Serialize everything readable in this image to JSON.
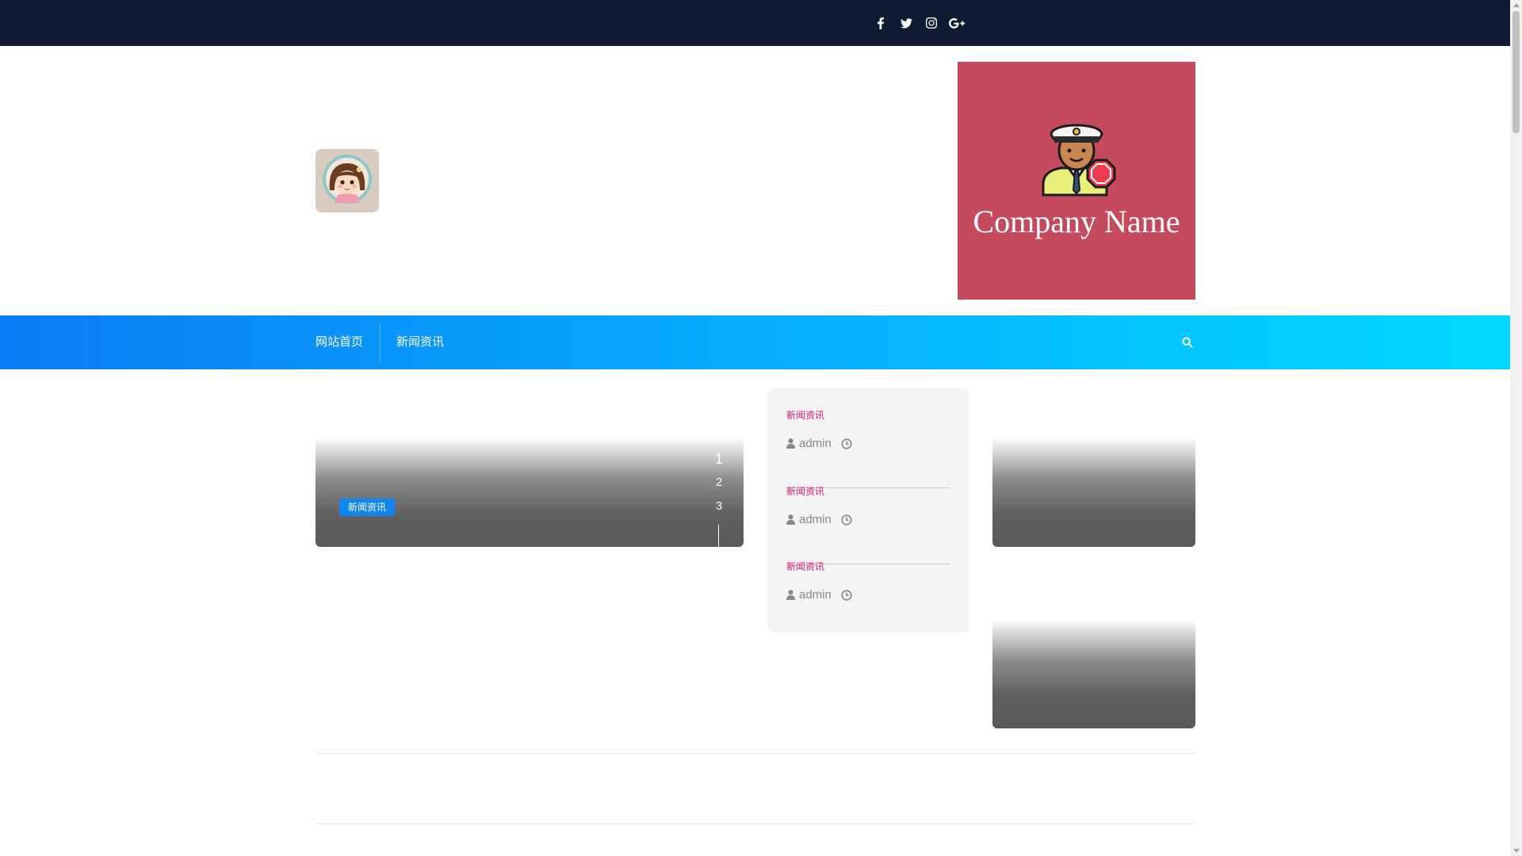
{
  "topbar": {
    "social_icons": [
      "facebook-icon",
      "twitter-icon",
      "instagram-icon",
      "google-plus-icon"
    ]
  },
  "header": {
    "logo_icon": "girl-avatar-logo",
    "banner": {
      "company_name": "Company Name",
      "icon": "security-guard-icon",
      "background": "#c54a5e"
    }
  },
  "nav": {
    "items": [
      {
        "label": "网站首页"
      },
      {
        "label": "新闻资讯"
      }
    ],
    "search_icon": "search-icon"
  },
  "slider": {
    "category": "新闻资讯",
    "pagination": [
      "1",
      "2",
      "3"
    ],
    "active_page": "1"
  },
  "posts": [
    {
      "category": "新闻资讯",
      "author": "admin"
    },
    {
      "category": "新闻资讯",
      "author": "admin"
    },
    {
      "category": "新闻资讯",
      "author": "admin"
    }
  ],
  "colors": {
    "topbar": "#0f1a33",
    "nav_gradient_start": "#0b7cf5",
    "nav_gradient_end": "#00d9ff",
    "badge": "#1187ee",
    "post_category": "#e0197a",
    "meta_text": "#888888"
  }
}
